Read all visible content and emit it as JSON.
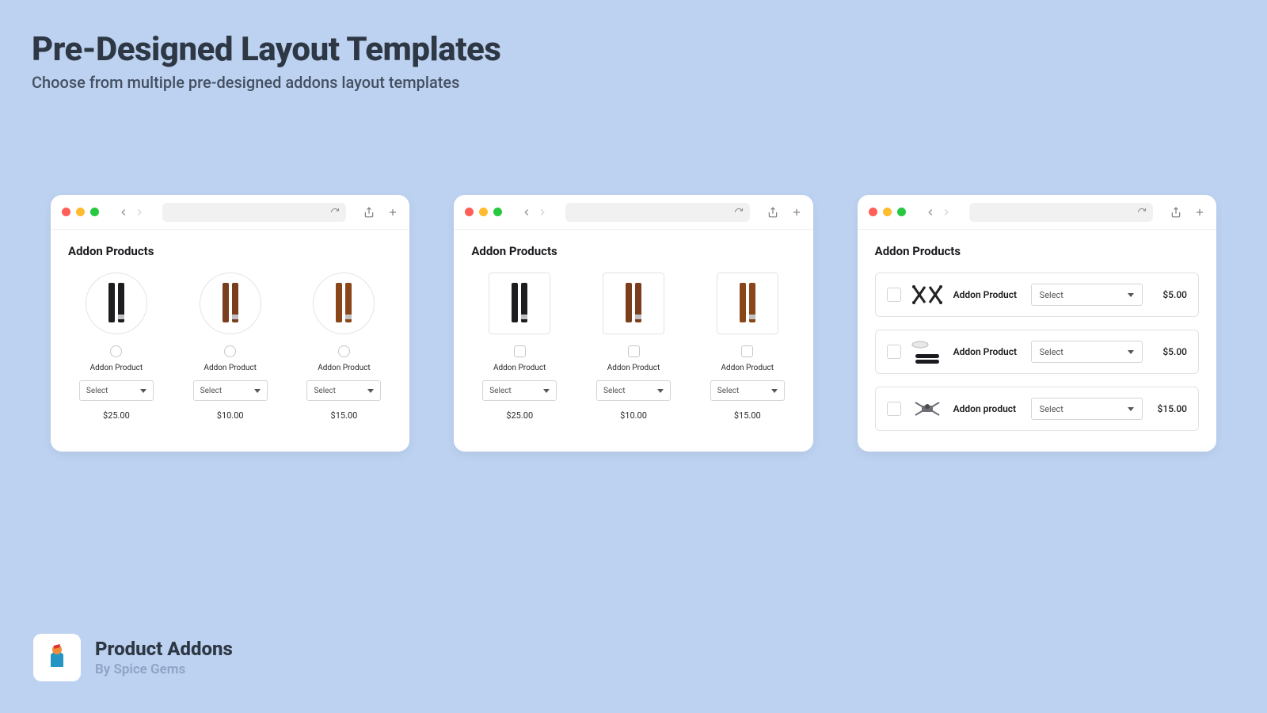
{
  "title": "Pre-Designed Layout Templates",
  "subtitle": "Choose from multiple pre-designed addons layout templates",
  "section_heading": "Addon Products",
  "select_label": "Select",
  "window1": {
    "items": [
      {
        "label": "Addon Product",
        "price": "$25.00"
      },
      {
        "label": "Addon Product",
        "price": "$10.00"
      },
      {
        "label": "Addon Product",
        "price": "$15.00"
      }
    ]
  },
  "window2": {
    "items": [
      {
        "label": "Addon Product",
        "price": "$25.00"
      },
      {
        "label": "Addon Product",
        "price": "$10.00"
      },
      {
        "label": "Addon Product",
        "price": "$15.00"
      }
    ]
  },
  "window3": {
    "items": [
      {
        "label": "Addon Product",
        "price": "$5.00"
      },
      {
        "label": "Addon Product",
        "price": "$5.00"
      },
      {
        "label": "Addon product",
        "price": "$15.00"
      }
    ]
  },
  "footer": {
    "app_name": "Product Addons",
    "by": "By Spice Gems"
  }
}
